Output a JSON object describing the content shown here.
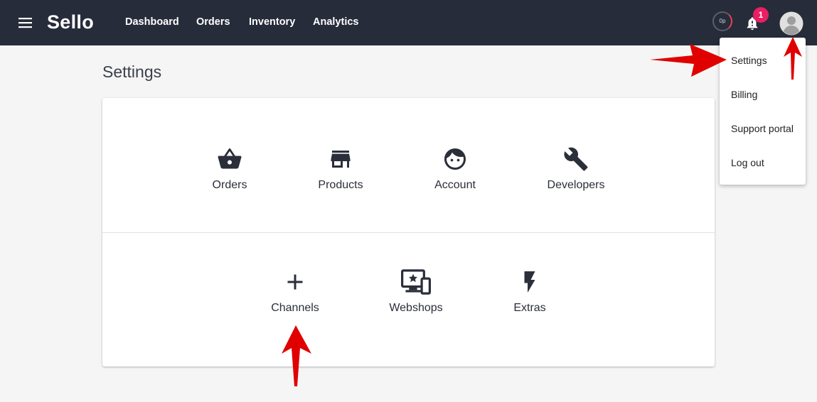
{
  "header": {
    "brand": "Sello",
    "nav": [
      "Dashboard",
      "Orders",
      "Inventory",
      "Analytics"
    ],
    "speed_badge": "0p",
    "notification_count": "1"
  },
  "page": {
    "title": "Settings"
  },
  "settings_tiles": {
    "primary": [
      {
        "label": "Orders",
        "icon": "basket-icon"
      },
      {
        "label": "Products",
        "icon": "store-icon"
      },
      {
        "label": "Account",
        "icon": "face-icon"
      },
      {
        "label": "Developers",
        "icon": "wrench-icon"
      }
    ],
    "secondary": [
      {
        "label": "Channels",
        "icon": "plus-icon"
      },
      {
        "label": "Webshops",
        "icon": "webshop-devices-icon"
      },
      {
        "label": "Extras",
        "icon": "flash-icon"
      }
    ]
  },
  "user_menu": {
    "items": [
      "Settings",
      "Billing",
      "Support portal",
      "Log out"
    ]
  },
  "colors": {
    "topbar": "#272c3a",
    "badge": "#e91e63",
    "annotation_arrow": "#e00000",
    "background": "#f5f5f5"
  }
}
